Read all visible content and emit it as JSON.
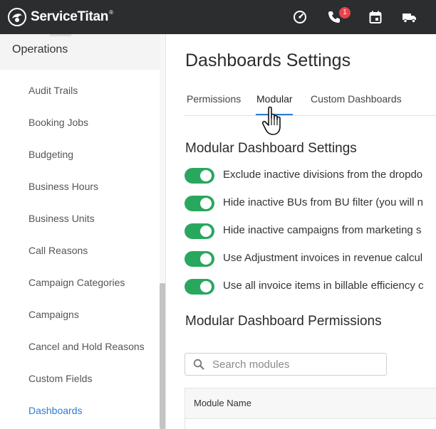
{
  "topbar": {
    "brand": "ServiceTitan",
    "brand_mark": "®",
    "phone_badge": "1",
    "icons": [
      "dashboard-gauge-icon",
      "phone-icon",
      "calendar-icon",
      "truck-icon"
    ]
  },
  "sidebar": {
    "section": "Operations",
    "items": [
      {
        "label": "Audit Trails"
      },
      {
        "label": "Booking Jobs"
      },
      {
        "label": "Budgeting"
      },
      {
        "label": "Business Hours"
      },
      {
        "label": "Business Units"
      },
      {
        "label": "Call Reasons"
      },
      {
        "label": "Campaign Categories"
      },
      {
        "label": "Campaigns"
      },
      {
        "label": "Cancel and Hold Reasons"
      },
      {
        "label": "Custom Fields"
      },
      {
        "label": "Dashboards"
      }
    ],
    "active_item": "Dashboards"
  },
  "main": {
    "title": "Dashboards Settings",
    "tabs": [
      {
        "label": "Permissions"
      },
      {
        "label": "Modular"
      },
      {
        "label": "Custom Dashboards"
      }
    ],
    "active_tab": "Modular",
    "settings_title": "Modular Dashboard Settings",
    "settings": [
      {
        "label": "Exclude inactive divisions from the dropdo",
        "enabled": true
      },
      {
        "label": "Hide inactive BUs from BU filter (you will n",
        "enabled": true
      },
      {
        "label": "Hide inactive campaigns from marketing s",
        "enabled": true
      },
      {
        "label": "Use Adjustment invoices in revenue calcul",
        "enabled": true
      },
      {
        "label": "Use all invoice items in billable efficiency c",
        "enabled": true
      }
    ],
    "permissions_title": "Modular Dashboard Permissions",
    "search": {
      "placeholder": "Search modules",
      "value": ""
    },
    "table": {
      "columns": [
        "Module Name"
      ]
    }
  },
  "colors": {
    "topbar": "#2b2d2f",
    "accent": "#2a7fd4",
    "toggle_on": "#2aa75f",
    "badge": "#e8434c"
  }
}
